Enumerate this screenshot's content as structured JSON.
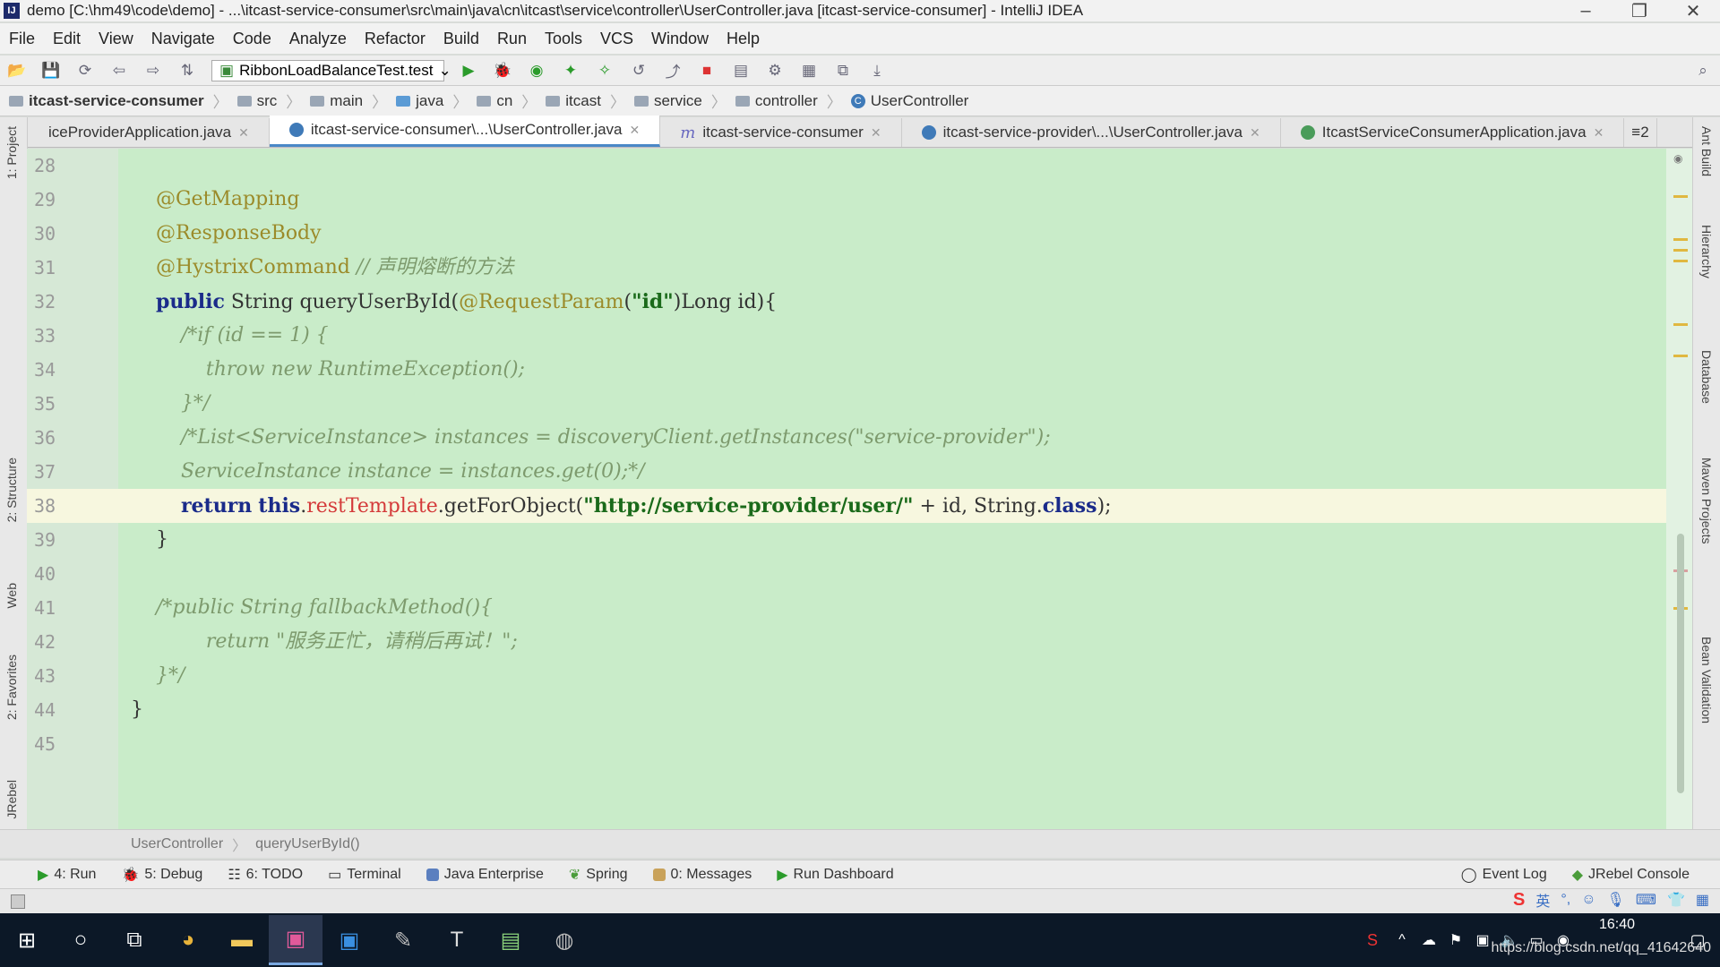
{
  "window": {
    "title": "demo [C:\\hm49\\code\\demo] - ...\\itcast-service-consumer\\src\\main\\java\\cn\\itcast\\service\\controller\\UserController.java [itcast-service-consumer] - IntelliJ IDEA",
    "app_icon": "IJ"
  },
  "menu": [
    "File",
    "Edit",
    "View",
    "Navigate",
    "Code",
    "Analyze",
    "Refactor",
    "Build",
    "Run",
    "Tools",
    "VCS",
    "Window",
    "Help"
  ],
  "toolbar": {
    "run_config": "RibbonLoadBalanceTest.test"
  },
  "breadcrumbs": [
    "itcast-service-consumer",
    "src",
    "main",
    "java",
    "cn",
    "itcast",
    "service",
    "controller",
    "UserController"
  ],
  "tabs": [
    {
      "label": "iceProviderApplication.java"
    },
    {
      "label": "itcast-service-consumer\\...\\UserController.java"
    },
    {
      "label": "itcast-service-consumer"
    },
    {
      "label": "itcast-service-provider\\...\\UserController.java"
    },
    {
      "label": "ItcastServiceConsumerApplication.java"
    }
  ],
  "tabs_overflow": "≡2",
  "left_tools": [
    "1: Project",
    "2: Structure",
    "Web",
    "2: Favorites",
    "JRebel"
  ],
  "right_tools": [
    "Ant Build",
    "Hierarchy",
    "Database",
    "Maven Projects",
    "Bean Validation"
  ],
  "gutter": {
    "line_numbers": [
      "28",
      "29",
      "30",
      "31",
      "32",
      "33",
      "34",
      "35",
      "36",
      "37",
      "38",
      "39",
      "40",
      "41",
      "42",
      "43",
      "44",
      "45"
    ]
  },
  "code": {
    "l29": "@GetMapping",
    "l30": "@ResponseBody",
    "l31_ann": "@HystrixCommand ",
    "l31_cmt": "// 声明熔断的方法",
    "l32_kw": "public",
    "l32_a": " String queryUserById(",
    "l32_ann": "@RequestParam",
    "l32_b": "(",
    "l32_str": "\"id\"",
    "l32_c": ")Long id){",
    "l33": "/*if (id == 1) {",
    "l34": "    throw new RuntimeException();",
    "l35": "}*/",
    "l36": "/*List<ServiceInstance> instances = discoveryClient.getInstances(\"service-provider\");",
    "l37": "ServiceInstance instance = instances.get(0);*/",
    "l38_kw1": "return",
    "l38_kw2": "this",
    "l38_dot": ".",
    "l38_fld": "restTemplate",
    "l38_a": ".getForObject(",
    "l38_str": "\"http://service-provider/user/\"",
    "l38_b": " + id, String.",
    "l38_kw3": "class",
    "l38_c": ");",
    "l39": "}",
    "l41": "/*public String fallbackMethod(){",
    "l42": "    return \"服务正忙，请稍后再试！\";",
    "l43": "}*/",
    "l44": "}"
  },
  "editor_breadcrumb": [
    "UserController",
    "queryUserById()"
  ],
  "toolwindows": [
    "4: Run",
    "5: Debug",
    "6: TODO",
    "Terminal",
    "Java Enterprise",
    "Spring",
    "0: Messages",
    "Run Dashboard"
  ],
  "toolwindows_right": [
    "Event Log",
    "JRebel Console"
  ],
  "taskbar": {
    "time": "16:40",
    "watermark": "https://blog.csdn.net/qq_41642640"
  }
}
